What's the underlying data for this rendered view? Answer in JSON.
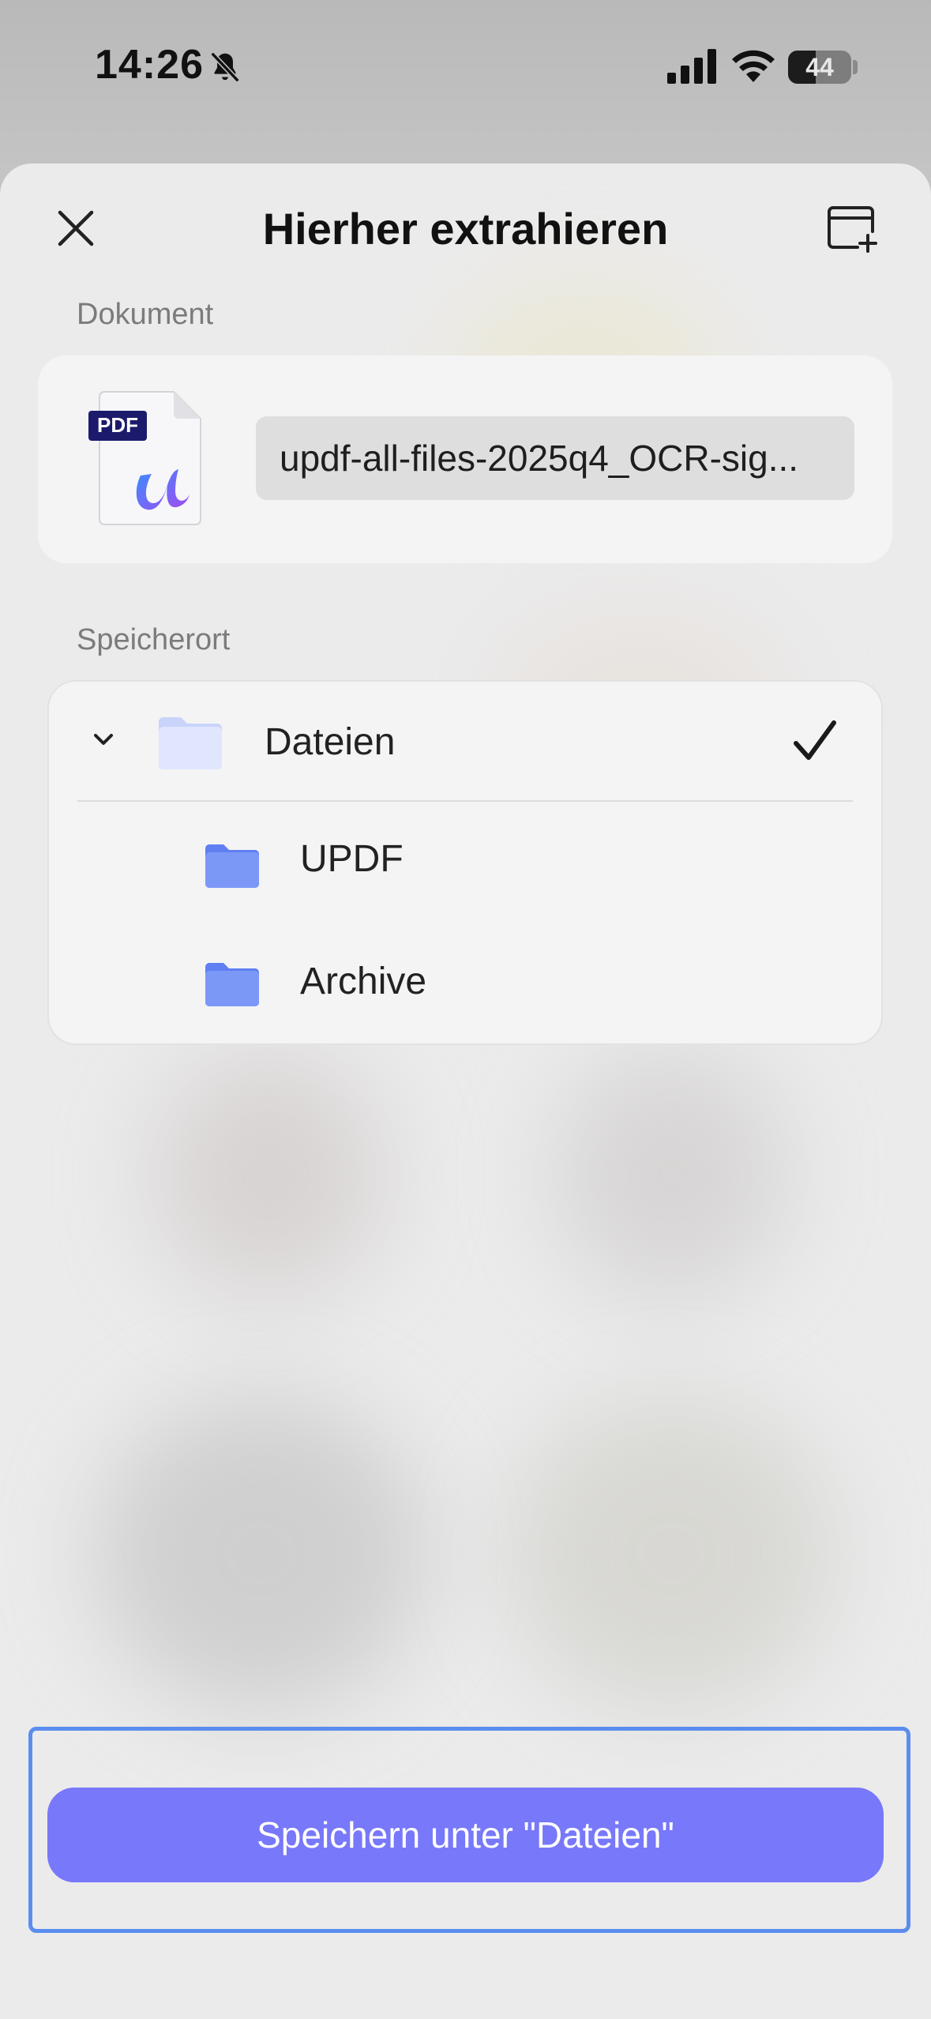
{
  "status_bar": {
    "time": "14:26",
    "battery_level": "44",
    "icons": [
      "bell-slash-icon",
      "cellular-signal-icon",
      "wifi-icon",
      "battery-icon"
    ]
  },
  "header": {
    "title": "Hierher extrahieren",
    "close_icon": "close-icon",
    "new_folder_icon": "new-folder-icon"
  },
  "document": {
    "section_label": "Dokument",
    "file_type_badge": "PDF",
    "file_name": "updf-all-files-2025q4_OCR-sig..."
  },
  "location": {
    "section_label": "Speicherort",
    "root": {
      "label": "Dateien",
      "expanded": true,
      "selected": true
    },
    "children": [
      {
        "label": "UPDF"
      },
      {
        "label": "Archive"
      }
    ]
  },
  "actions": {
    "save_label": "Speichern unter \"Dateien\""
  },
  "colors": {
    "accent_button": "#7878fa",
    "focus_frame": "#5b8def",
    "folder_blue": "#6f8ff5"
  }
}
